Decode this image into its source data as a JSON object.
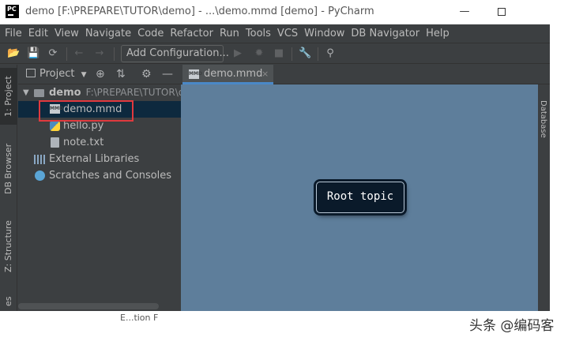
{
  "window": {
    "app_logo": "PC",
    "title": "demo [F:\\PREPARE\\TUTOR\\demo] - ...\\demo.mmd [demo] - PyCharm",
    "minimize": "—",
    "maximize": ""
  },
  "menu": [
    "File",
    "Edit",
    "View",
    "Navigate",
    "Code",
    "Refactor",
    "Run",
    "Tools",
    "VCS",
    "Window",
    "DB Navigator",
    "Help"
  ],
  "toolbar": {
    "add_configuration": "Add Configuration..."
  },
  "left_strip": {
    "project_tab": "1: Project",
    "db_browser_tab": "DB Browser",
    "structure_tab": "Z: Structure",
    "favorites_tab": "es"
  },
  "project_panel": {
    "title": "Project",
    "dropdown_arrow": "▼",
    "tree": {
      "root_name": "demo",
      "root_path": "F:\\PREPARE\\TUTOR\\d",
      "files": [
        "demo.mmd",
        "hello.py",
        "note.txt"
      ],
      "external_libraries": "External Libraries",
      "scratches": "Scratches and Consoles"
    }
  },
  "editor": {
    "tab_label": "demo.mmd",
    "tab_close": "×",
    "node_text": "Root topic",
    "right_strip_text": "Database"
  },
  "bottom_partial": "E...tion F",
  "watermark": "头条 @编码客"
}
